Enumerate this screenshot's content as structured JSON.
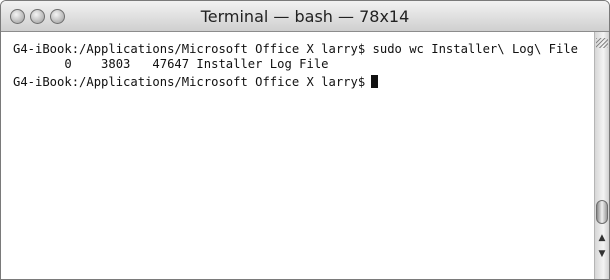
{
  "window": {
    "title": "Terminal — bash — 78x14"
  },
  "terminal": {
    "line1": "G4-iBook:/Applications/Microsoft Office X larry$ sudo wc Installer\\ Log\\ File",
    "line2": "       0    3803   47647 Installer Log File",
    "line3": "G4-iBook:/Applications/Microsoft Office X larry$"
  },
  "icons": {
    "close": "close-icon",
    "minimize": "minimize-icon",
    "zoom": "zoom-icon",
    "scroll_up": "up-arrow-icon",
    "scroll_down": "down-arrow-icon"
  },
  "scroll_arrows": {
    "up": "▲",
    "down": "▼"
  }
}
